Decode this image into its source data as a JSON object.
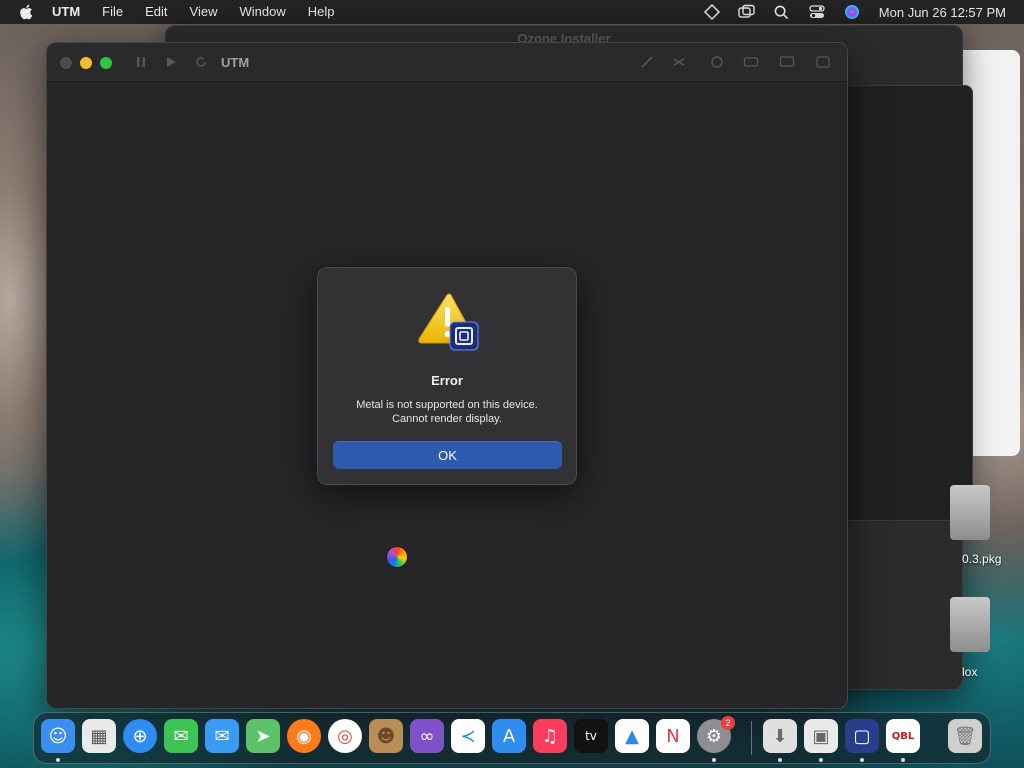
{
  "menubar": {
    "app_name": "UTM",
    "items": [
      "File",
      "Edit",
      "View",
      "Window",
      "Help"
    ],
    "clock": "Mon Jun 26  12:57 PM",
    "status_icons": [
      "diamond-icon",
      "window-overlap-icon",
      "search-icon",
      "control-center-icon",
      "siri-icon"
    ]
  },
  "background_window": {
    "title": "Ozone Installer"
  },
  "desktop": {
    "items": [
      {
        "label": "0.3.pkg"
      },
      {
        "label": "lox"
      }
    ]
  },
  "utm_window": {
    "title": "UTM"
  },
  "alert": {
    "title": "Error",
    "message_line1": "Metal is not supported on this device.",
    "message_line2": "Cannot render display.",
    "ok_label": "OK"
  },
  "dock": {
    "items": [
      {
        "name": "finder",
        "color": "#3b8ef0"
      },
      {
        "name": "launchpad",
        "color": "#e9e9e9"
      },
      {
        "name": "safari",
        "color": "#2f8cf0"
      },
      {
        "name": "messages",
        "color": "#3ec454"
      },
      {
        "name": "mail",
        "color": "#3a9bf5"
      },
      {
        "name": "maps",
        "color": "#5cc36a"
      },
      {
        "name": "firefox",
        "color": "#ff7a18"
      },
      {
        "name": "chrome",
        "color": "#ffffff"
      },
      {
        "name": "contacts",
        "color": "#b98c58"
      },
      {
        "name": "visual-studio",
        "color": "#7f52c9"
      },
      {
        "name": "vscode",
        "color": "#ffffff"
      },
      {
        "name": "app-store",
        "color": "#2f8cf0"
      },
      {
        "name": "music",
        "color": "#fb3d5b"
      },
      {
        "name": "tv",
        "color": "#111111"
      },
      {
        "name": "keynote",
        "color": "#ffffff"
      },
      {
        "name": "news",
        "color": "#ffffff"
      },
      {
        "name": "system-settings",
        "color": "#8d8d92"
      },
      {
        "name": "downloads",
        "color": "#e0e0e0"
      },
      {
        "name": "installer",
        "color": "#eaeaea"
      },
      {
        "name": "utm",
        "color": "#2a3d8c"
      },
      {
        "name": "qbl",
        "color": "#ffffff"
      },
      {
        "name": "trash",
        "color": "#cfcfcf"
      }
    ],
    "settings_badge": "2",
    "tv_label": "tv",
    "qbl_label": "QBL"
  }
}
